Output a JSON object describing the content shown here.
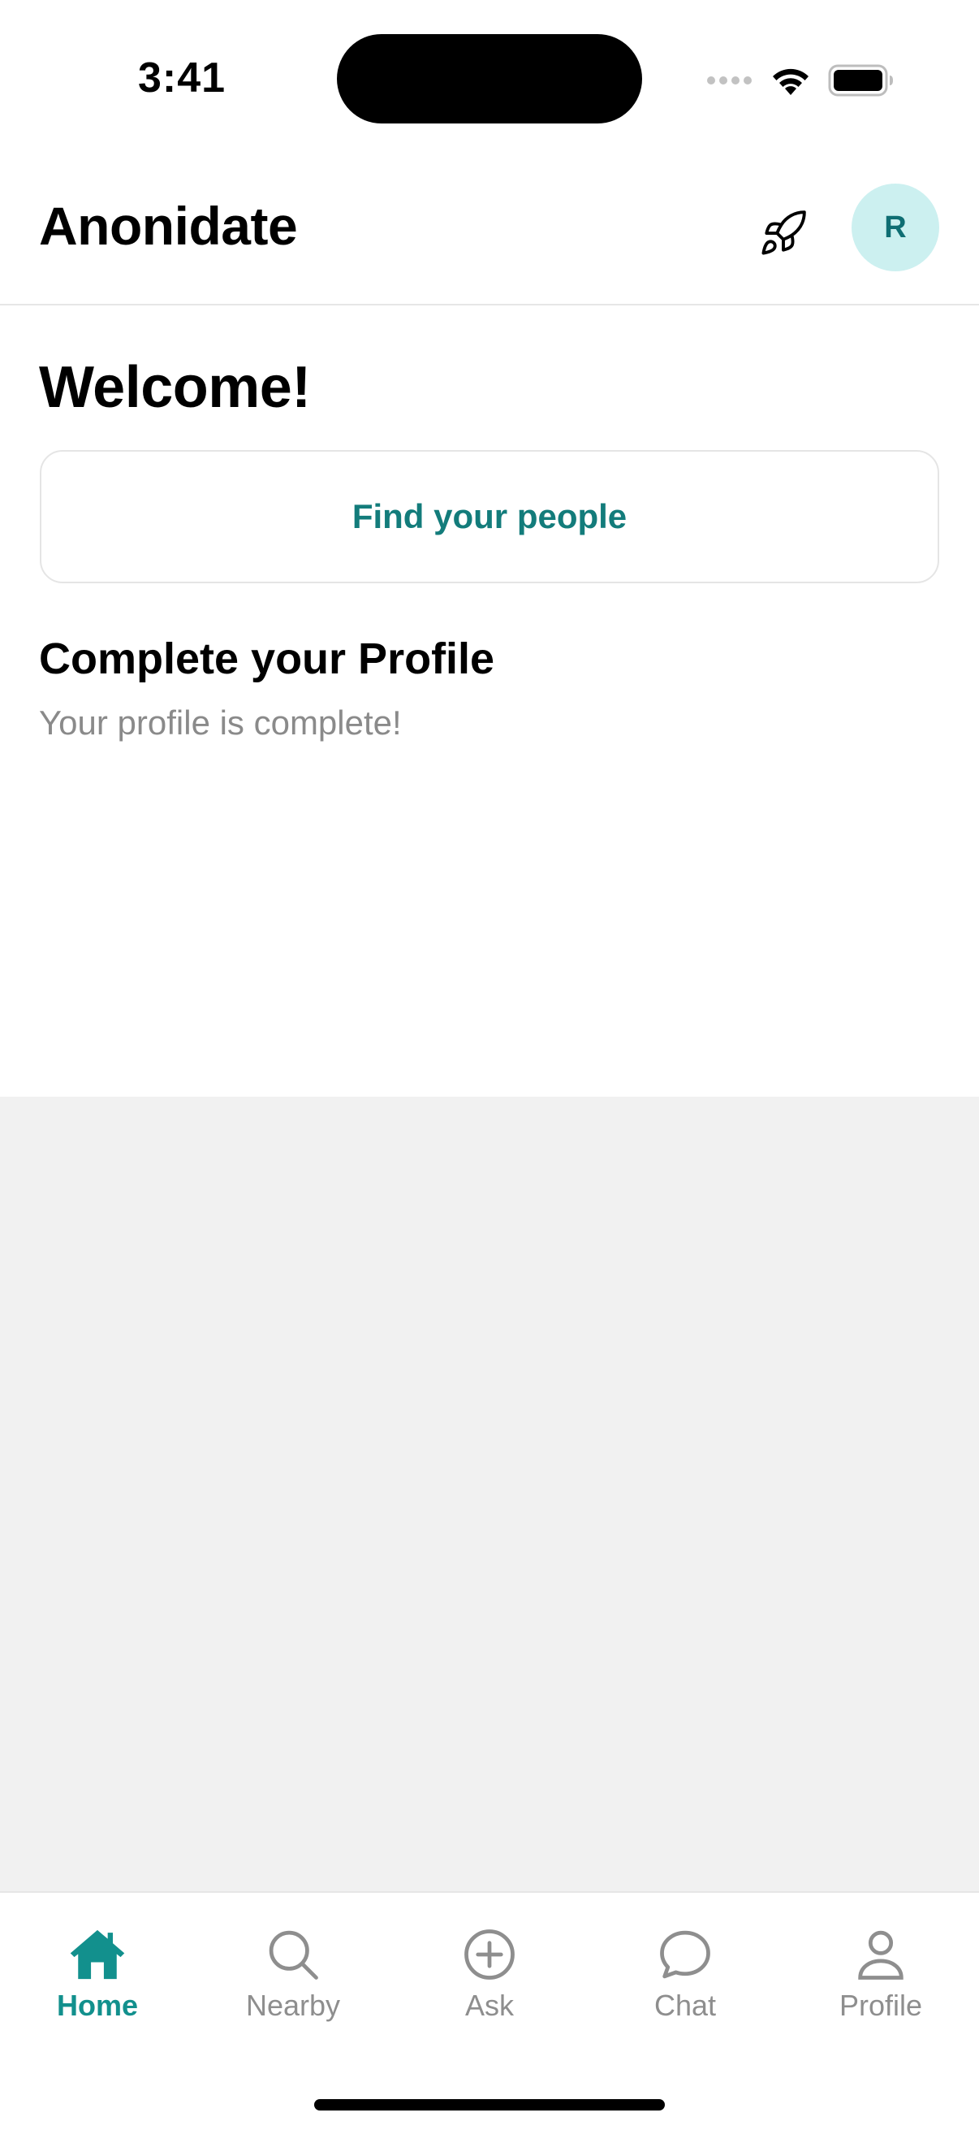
{
  "status_bar": {
    "time": "3:41"
  },
  "header": {
    "title": "Anonidate",
    "rocket_icon": "rocket-icon",
    "avatar_initial": "R"
  },
  "main": {
    "welcome": "Welcome!",
    "find_people_label": "Find your people",
    "profile_section": {
      "title": "Complete your Profile",
      "status": "Your profile is complete!"
    }
  },
  "tabs": [
    {
      "label": "Home",
      "icon": "home-icon",
      "active": true
    },
    {
      "label": "Nearby",
      "icon": "search-icon",
      "active": false
    },
    {
      "label": "Ask",
      "icon": "plus-circle-icon",
      "active": false
    },
    {
      "label": "Chat",
      "icon": "chat-bubble-icon",
      "active": false
    },
    {
      "label": "Profile",
      "icon": "person-icon",
      "active": false
    }
  ],
  "colors": {
    "accent": "#12908D",
    "accent_text": "#137C7B",
    "avatar_bg": "#CCF0F0",
    "inactive": "#8E8E8E",
    "background_grey": "#F1F1F1"
  }
}
